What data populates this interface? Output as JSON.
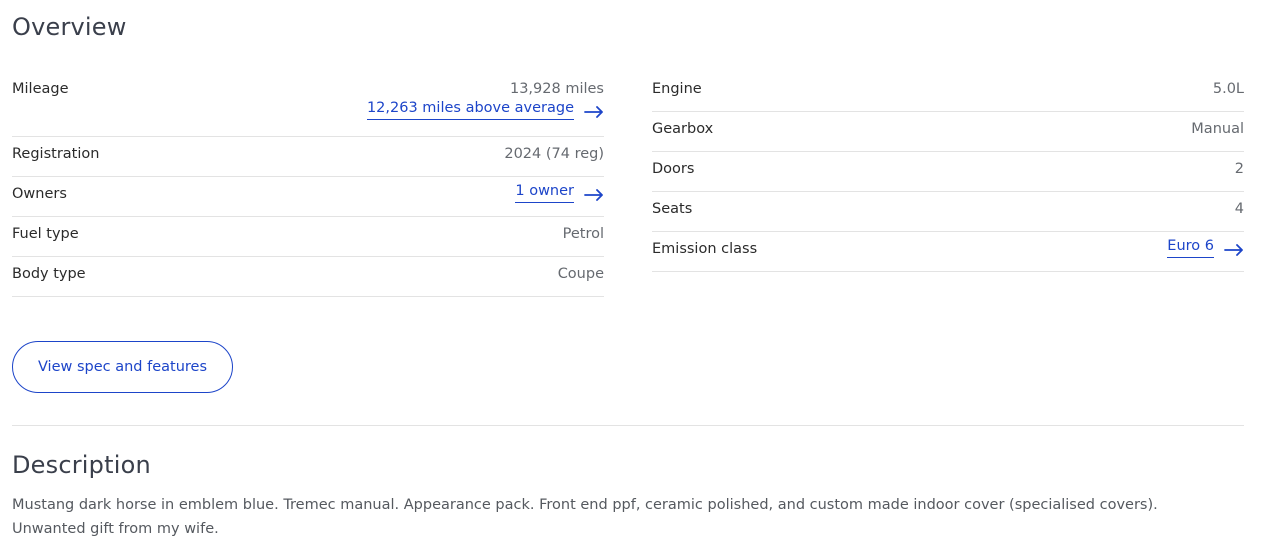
{
  "overview": {
    "title": "Overview",
    "left": {
      "mileage": {
        "label": "Mileage",
        "value": "13,928 miles",
        "link": "12,263 miles above average"
      },
      "registration": {
        "label": "Registration",
        "value": "2024 (74 reg)"
      },
      "owners": {
        "label": "Owners",
        "link": "1 owner"
      },
      "fuel": {
        "label": "Fuel type",
        "value": "Petrol"
      },
      "body": {
        "label": "Body type",
        "value": "Coupe"
      }
    },
    "right": {
      "engine": {
        "label": "Engine",
        "value": "5.0L"
      },
      "gearbox": {
        "label": "Gearbox",
        "value": "Manual"
      },
      "doors": {
        "label": "Doors",
        "value": "2"
      },
      "seats": {
        "label": "Seats",
        "value": "4"
      },
      "emission": {
        "label": "Emission class",
        "link": "Euro 6"
      }
    },
    "button_label": "View spec and features"
  },
  "description": {
    "title": "Description",
    "text": "Mustang dark horse in emblem blue. Tremec manual. Appearance pack. Front end ppf, ceramic polished, and custom made indoor cover (specialised covers). Unwanted gift from my wife."
  },
  "colors": {
    "link": "#1d45c9",
    "divider": "#e3e3e3"
  }
}
